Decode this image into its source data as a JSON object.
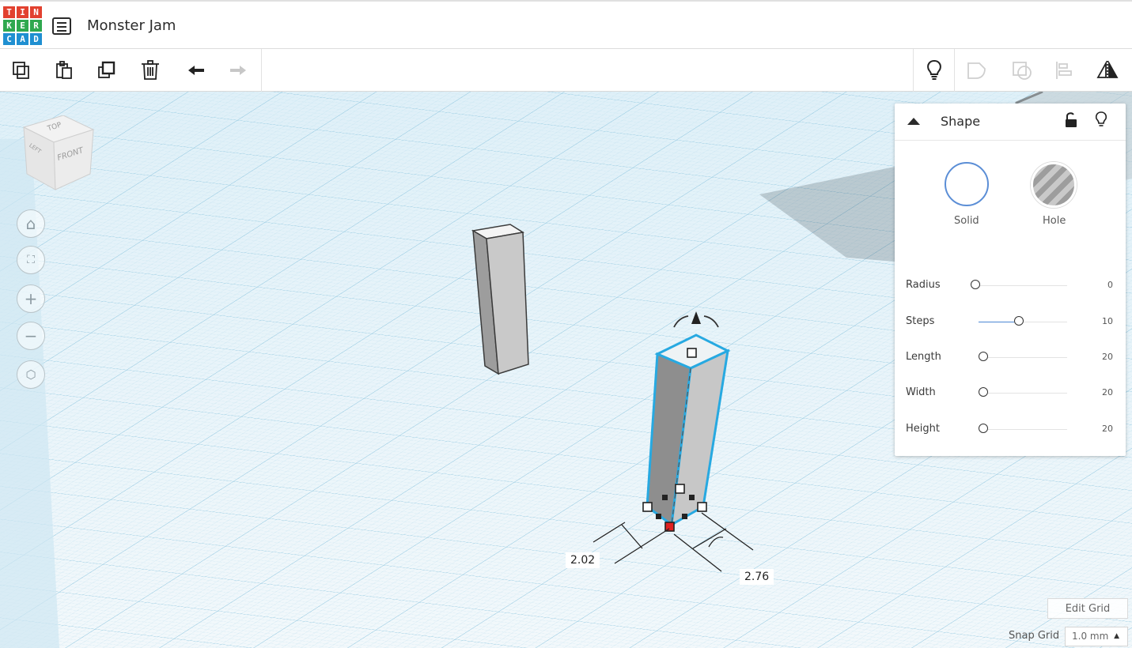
{
  "app": {
    "logo_letters": [
      "T",
      "I",
      "N",
      "K",
      "E",
      "R",
      "C",
      "A",
      "D"
    ],
    "title": "Monster Jam"
  },
  "toolbar": {
    "left_icons": [
      "copy-icon",
      "paste-icon",
      "duplicate-icon",
      "trash-icon",
      "undo-icon",
      "redo-icon"
    ],
    "right_icons": [
      "lightbulb-icon",
      "group-icon",
      "ungroup-icon",
      "align-icon",
      "mirror-icon"
    ]
  },
  "viewcube": {
    "top": "TOP",
    "front": "FRONT",
    "left": "LEFT"
  },
  "view_controls": [
    "home-icon",
    "fit-icon",
    "zoom-in-icon",
    "zoom-out-icon",
    "perspective-icon"
  ],
  "shape_panel": {
    "title": "Shape",
    "solid_label": "Solid",
    "hole_label": "Hole",
    "props": [
      {
        "name": "Radius",
        "value": "0",
        "fraction": 0.0
      },
      {
        "name": "Steps",
        "value": "10",
        "fraction": 0.4
      },
      {
        "name": "Length",
        "value": "20",
        "fraction": 0.0
      },
      {
        "name": "Width",
        "value": "20",
        "fraction": 0.0
      },
      {
        "name": "Height",
        "value": "20",
        "fraction": 0.0
      }
    ]
  },
  "dimensions": {
    "a": "2.02",
    "b": "2.76"
  },
  "grid": {
    "edit_label": "Edit Grid",
    "snap_label": "Snap Grid",
    "snap_value": "1.0 mm"
  },
  "colors": {
    "grid_line": "#a9d6ea",
    "grid_bg": "#eef7fb",
    "selection": "#27a9e1",
    "accent_blue": "#4a86d4"
  }
}
